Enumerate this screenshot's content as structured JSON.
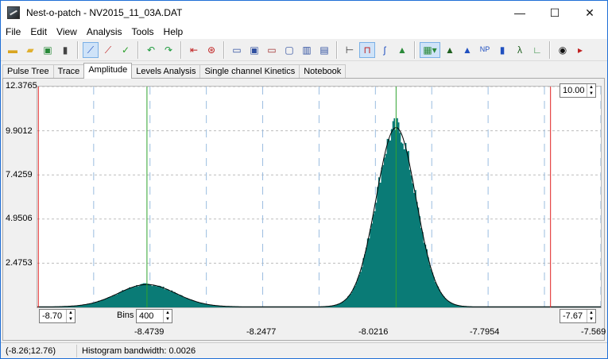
{
  "window": {
    "title": "Nest-o-patch - NV2015_11_03A.DAT",
    "min_glyph": "—",
    "max_glyph": "☐",
    "close_glyph": "✕"
  },
  "menu": [
    "File",
    "Edit",
    "View",
    "Analysis",
    "Tools",
    "Help"
  ],
  "tabs": [
    "Pulse Tree",
    "Trace",
    "Amplitude",
    "Levels Analysis",
    "Single channel Kinetics",
    "Notebook"
  ],
  "active_tab": "Amplitude",
  "plot": {
    "y_ticks": [
      "12.3765",
      "9.9012",
      "7.4259",
      "4.9506",
      "2.4753"
    ],
    "x_ticks": [
      "-8.4739",
      "-8.2477",
      "-8.0216",
      "-7.7954",
      "-7.569"
    ],
    "right_top_value": "10.00",
    "left_bottom_value": "-8.70",
    "right_bottom_value": "-7.67",
    "bins_label": "Bins",
    "bins_value": "400",
    "colors": {
      "fill": "#0a7b76",
      "fit": "#000000",
      "marker": "#2fa32f",
      "bound": "#e02020",
      "grid": "#9bbde0"
    }
  },
  "chart_data": {
    "type": "area",
    "title": "",
    "xlabel": "",
    "ylabel": "",
    "xlim": [
      -8.7,
      -7.569
    ],
    "ylim": [
      0,
      12.3765
    ],
    "y_ticks": [
      2.4753,
      4.9506,
      7.4259,
      9.9012,
      12.3765
    ],
    "x_ticks": [
      -8.4739,
      -8.2477,
      -8.0216,
      -7.7954,
      -7.569
    ],
    "grid": true,
    "lower_bound": -8.7,
    "upper_bound": -7.67,
    "level_markers": [
      -8.48,
      -7.98
    ],
    "series": [
      {
        "values_description_free": true,
        "components": [
          {
            "mean": -8.48,
            "sd": 0.058,
            "peak": 1.25
          },
          {
            "mean": -7.98,
            "sd": 0.04,
            "peak": 10.05
          }
        ]
      }
    ]
  },
  "status": {
    "coords": "(-8.26;12.76)",
    "bandwidth": "Histogram bandwidth: 0.0026"
  }
}
